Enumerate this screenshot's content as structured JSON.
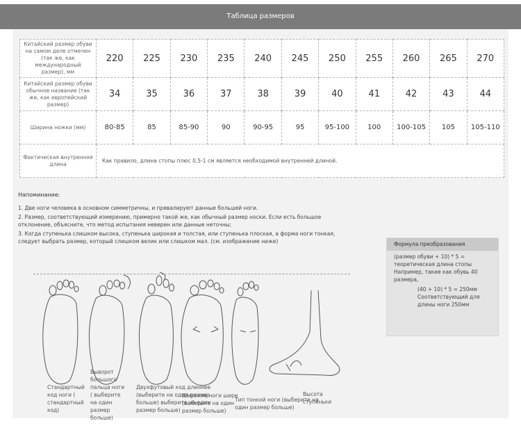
{
  "header": {
    "title": "Таблица размеров"
  },
  "table": {
    "rows": [
      {
        "label": "Китайский размер обуви на самом деле отмечен (так же, как международный размер), мм",
        "values": [
          "220",
          "225",
          "230",
          "235",
          "240",
          "245",
          "250",
          "255",
          "260",
          "265",
          "270"
        ]
      },
      {
        "label": "Китайский размер обуви обычное название (так же, как европейский размер)",
        "values": [
          "34",
          "35",
          "36",
          "37",
          "38",
          "39",
          "40",
          "41",
          "42",
          "43",
          "44"
        ]
      },
      {
        "label": "Ширина ножки (мм)",
        "values": [
          "80-85",
          "85",
          "85-90",
          "90",
          "90-95",
          "95",
          "95-100",
          "100",
          "100-105",
          "105",
          "105-110"
        ]
      }
    ],
    "last_row": {
      "label": "Фактическая внутренняя длина",
      "note": "Как правило, длина стопы плюс 0,5-1 см является необходимой внутренней длиной."
    }
  },
  "reminder": {
    "title": "Напоминание:"
  },
  "tips": [
    "1. Две ноги человека в основном симметричны, и превалируют данные большей ноги.",
    "2. Размер, соответствующий измерению, примерно такой же, как обычный размер носки. Если есть большое отклонение, объясните, что метод испытания неверен или данные неточны;",
    "3. Когда ступенька слишком высока, ступенька широкая и толстая, или ступенька плоская, а форма ноги тонкая, следует выбрать размер, который слишком велик или слишком мал. (см. изображение ниже)"
  ],
  "formula": {
    "title": "Формула преобразования",
    "text": "(размер обуви + 10) * 5 = теоретическая длина стопы Например, такие как обувь 40 размера,",
    "calc": "(40 + 10) * 5 = 250мм Соответствующий для длины ноги 250мм"
  },
  "feet": [
    {
      "label": "Стандартный код ноги ( стандартный код)"
    },
    {
      "label": "Выворот большого пальца ноги ( выберите на один размер больше)"
    },
    {
      "label": "Двухфутовый код длиннее (выберите на один размер больше) выберите на один размер больше)"
    },
    {
      "label": "Широкие ноги шире (выберите на один размер больше)"
    },
    {
      "label": "Тип тонкой ноги (выберите на один размер больше)"
    },
    {
      "label": "Высота ступеньки"
    }
  ]
}
